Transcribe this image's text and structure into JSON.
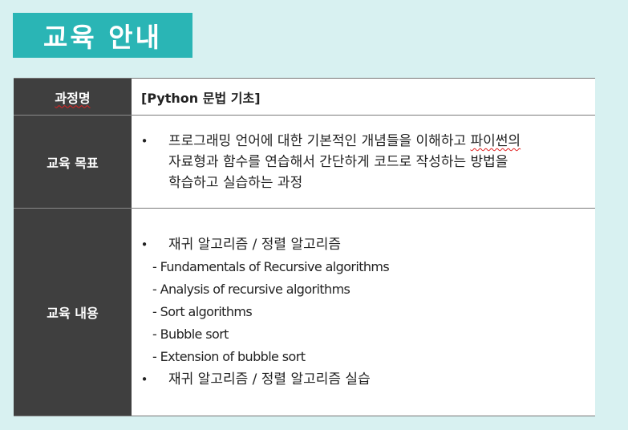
{
  "title": "교육 안내",
  "table": {
    "course_name": {
      "label": "과정명",
      "value": "[Python 문법 기초]"
    },
    "goal": {
      "label": "교육 목표",
      "line1_a": "프로그래밍 언어에 대한 기본적인 개념들을 이해하고 ",
      "line1_b": "파이썬의",
      "line2": "자료형과 함수를 연습해서 간단하게 코드로 작성하는 방법을",
      "line3": "학습하고 실습하는 과정"
    },
    "content": {
      "label": "교육 내용",
      "bullet1": "재귀 알고리즘 / 정렬 알고리즘",
      "sub_items": [
        "- Fundamentals of Recursive algorithms",
        "- Analysis of recursive algorithms",
        "- Sort algorithms",
        "- Bubble sort",
        "- Extension of bubble sort"
      ],
      "bullet2": "재귀 알고리즘 / 정렬 알고리즘 실습"
    },
    "bullet_char": "•"
  }
}
